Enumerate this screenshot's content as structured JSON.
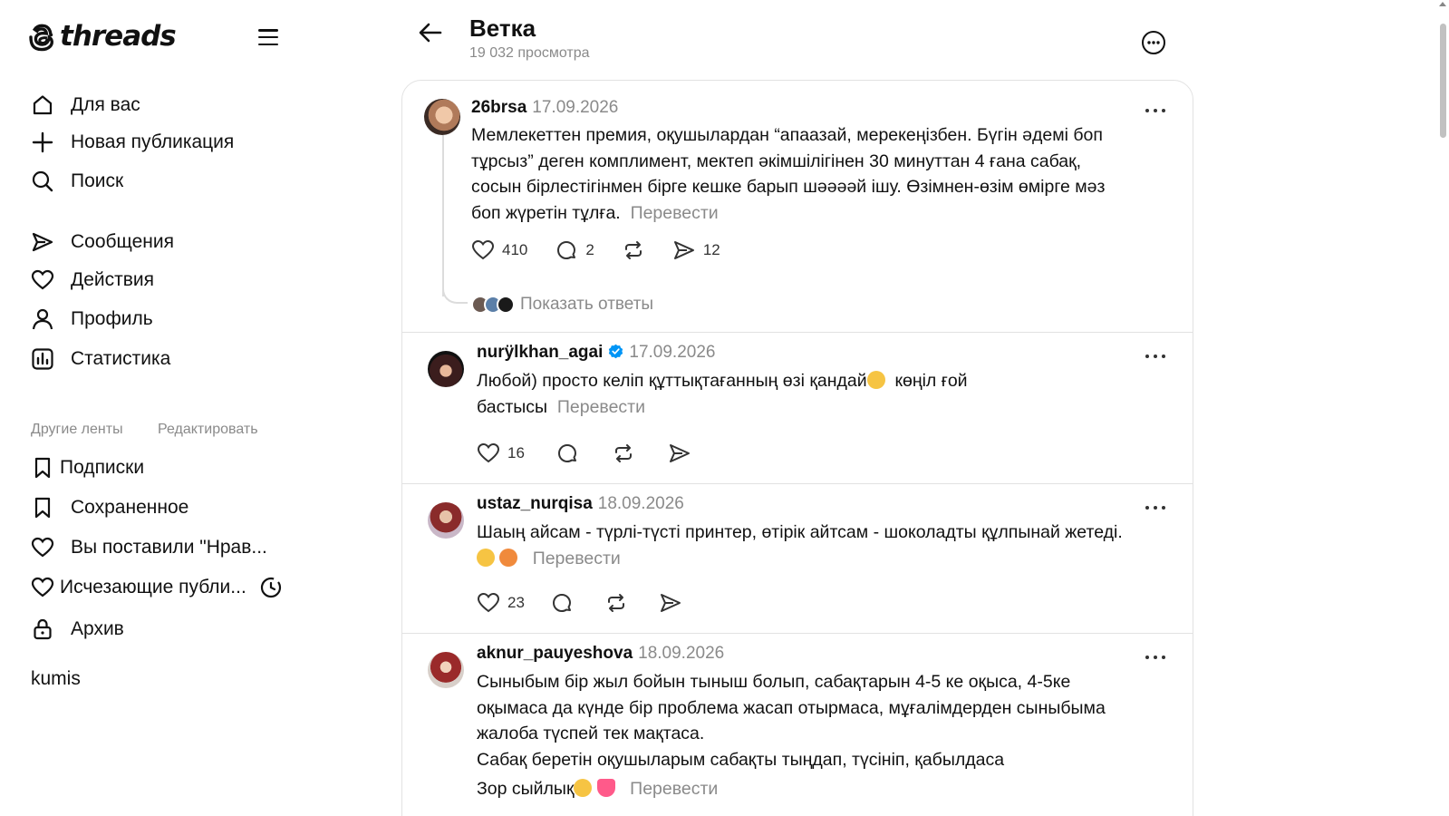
{
  "app": {
    "logo_text": "threads"
  },
  "nav": {
    "main": [
      {
        "label": "Для вас",
        "icon": "home-icon"
      },
      {
        "label": "Новая публикация",
        "icon": "plus-icon"
      },
      {
        "label": "Поиск",
        "icon": "search-icon"
      },
      {
        "label": "Сообщения",
        "icon": "send-icon"
      },
      {
        "label": "Действия",
        "icon": "heart-icon"
      },
      {
        "label": "Профиль",
        "icon": "user-icon"
      },
      {
        "label": "Статистика",
        "icon": "stats-icon"
      }
    ],
    "other_feeds_label": "Другие ленты",
    "edit_label": "Редактировать",
    "feeds": [
      {
        "label": "Подписки",
        "icon": "bookmark-icon"
      },
      {
        "label": "Сохраненное",
        "icon": "bookmark-icon"
      },
      {
        "label": "Вы поставили \"Нрав...",
        "icon": "heart-icon"
      },
      {
        "label": "Исчезающие публи...",
        "icon": "heart-icon"
      },
      {
        "label": "Архив",
        "icon": "lock-icon"
      }
    ],
    "custom_feed": "kumis"
  },
  "header": {
    "title": "Ветка",
    "views": "19 032 просмотра"
  },
  "posts": [
    {
      "username": "26brsa",
      "date": "17.09.2026",
      "verified": false,
      "lines": [
        "Мемлекеттен премия, оқушылардан “апаазай, мерекеңізбен. Бүгін әдемі боп",
        "тұрсыз” деген комплимент, мектеп әкімшілігінен 30 минуттан 4 ғана сабақ,",
        "сосын бірлестігінмен бірге кешке барып шәәәәй ішу. Өзімнен-өзім өмірге мәз",
        "боп жүретін тұлға."
      ],
      "translate": "Перевести",
      "likes": "410",
      "comments": "2",
      "reposts": "",
      "shares": "12",
      "show_replies": "Показать ответы"
    },
    {
      "username": "nurÿlkhan_agai",
      "date": "17.09.2026",
      "verified": true,
      "lines": [
        "Любой) просто келіп құттықтағанның өзі қандай",
        "бастысы"
      ],
      "line1_suffix": "көңіл ғой",
      "translate": "Перевести",
      "likes": "16"
    },
    {
      "username": "ustaz_nurqisa",
      "date": "18.09.2026",
      "verified": false,
      "lines": [
        "Шаың айсам - түрлі-түсті принтер, өтірік айтсам - шоколадты құлпынай жетеді."
      ],
      "translate": "Перевести",
      "likes": "23"
    },
    {
      "username": "aknur_pauyeshova",
      "date": "18.09.2026",
      "verified": false,
      "lines": [
        "Сыныбым бір жыл бойын тыныш болып, сабақтарын 4-5 ке оқыса, 4-5ке",
        "оқымаса да күнде бір проблема жасап отырмаса, мұғалімдерден сыныбыма",
        "жалоба түспей тек мақтаса.",
        "Сабақ беретін оқушыларым сабақты тыңдап, түсініп, қабылдаса",
        "Зор сыйлық"
      ],
      "translate": "Перевести"
    }
  ],
  "colors": {
    "accent_verified": "#0095f6",
    "muted_text": "#8a8a8a",
    "border": "#e2e2e2"
  }
}
